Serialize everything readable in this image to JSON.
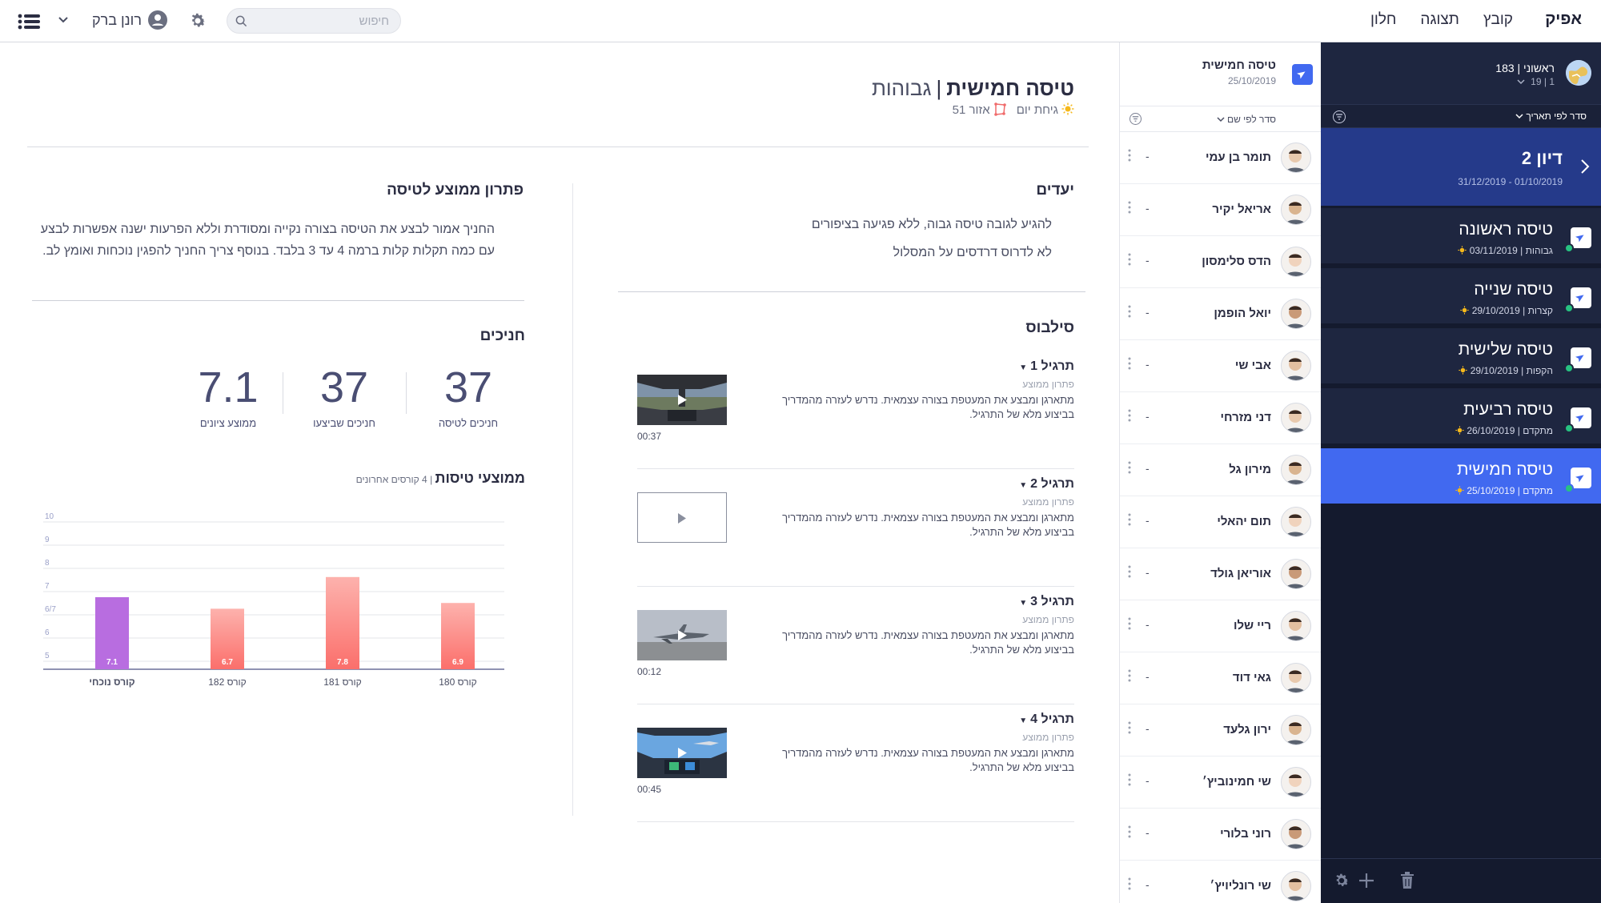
{
  "app": {
    "brand": "אפיק"
  },
  "menu": [
    "קובץ",
    "תצוגה",
    "חלון"
  ],
  "topbar": {
    "search_placeholder": "חיפוש",
    "user_name": "רונן ברק"
  },
  "course": {
    "title": "ראשוני | 183",
    "sub": "1 | 19"
  },
  "dark_sort_label": "סדר לפי תאריך",
  "discussion": {
    "title": "דיון 2",
    "dates": "01/10/2019 - 31/12/2019"
  },
  "flights": [
    {
      "name": "טיסה ראשונה",
      "date": "03/11/2019",
      "topic": "גבוהות",
      "active": false
    },
    {
      "name": "טיסה שנייה",
      "date": "29/10/2019",
      "topic": "קצרות",
      "active": false
    },
    {
      "name": "טיסה שלישית",
      "date": "29/10/2019",
      "topic": "הקפות",
      "active": false
    },
    {
      "name": "טיסה רביעית",
      "date": "26/10/2019",
      "topic": "מתקדם",
      "active": false
    },
    {
      "name": "טיסה חמישית",
      "date": "25/10/2019",
      "topic": "מתקדם",
      "active": true
    }
  ],
  "students_panel": {
    "title": "טיסה חמישית",
    "date": "25/10/2019",
    "sort_label": "סדר לפי שם",
    "dash": "-"
  },
  "students": [
    "תומר בן עמי",
    "אריאל יקיר",
    "הדס סלימסון",
    "יואל הופמן",
    "אבי שי",
    "דני מזרחי",
    "מירון גל",
    "תום יהאלי",
    "אוריאן גולד",
    "ריי שלו",
    "גאי דוד",
    "ירון גלעד",
    "שי חמינוביץ׳",
    "רוני בלורי",
    "שי רונליויץ׳"
  ],
  "main": {
    "title": "טיסה חמישית",
    "subtitle": "גבוהות",
    "time": "גיחת יום",
    "area": "אזור 51"
  },
  "goals": {
    "heading": "יעדים",
    "items": [
      "להגיע לגובה טיסה גבוה, ללא פגיעה בציפורים",
      "לא לדרוס דרדסים על המסלול"
    ]
  },
  "solution": {
    "heading": "פתרון ממוצע לטיסה",
    "text": "החניך אמור לבצע את הטיסה בצורה נקייה ומסודרת וללא הפרעות ישנה אפשרות לבצע עם כמה תקלות קלות ברמה 4 עד 3 בלבד. בנוסף צריך החניך להפגין נוכחות ואומץ לב."
  },
  "syllabus": {
    "heading": "סילבוס",
    "exercises": [
      {
        "title": "תרגיל 1",
        "sub": "פתרון ממוצע",
        "desc": "מתארגן ומבצע את המעטפת בצורה עצמאית. נדרש לעזרה מהמדריך בביצוע מלא של התרגיל.",
        "duration": "00:37",
        "thumb": "cockpit"
      },
      {
        "title": "תרגיל 2",
        "sub": "פתרון ממוצע",
        "desc": "מתארגן ומבצע את המעטפת בצורה עצמאית. נדרש לעזרה מהמדריך בביצוע מלא של התרגיל.",
        "duration": "",
        "thumb": "empty"
      },
      {
        "title": "תרגיל 3",
        "sub": "פתרון ממוצע",
        "desc": "מתארגן ומבצע את המעטפת בצורה עצמאית. נדרש לעזרה מהמדריך בביצוע מלא של התרגיל.",
        "duration": "00:12",
        "thumb": "runway"
      },
      {
        "title": "תרגיל 4",
        "sub": "פתרון ממוצע",
        "desc": "מתארגן ומבצע את המעטפת בצורה עצמאית. נדרש לעזרה מהמדריך בביצוע מלא של התרגיל.",
        "duration": "00:45",
        "thumb": "sky"
      }
    ]
  },
  "trainees": {
    "heading": "חניכים",
    "stats": [
      {
        "value": "37",
        "label": "חניכים לטיסה"
      },
      {
        "value": "37",
        "label": "חניכים שביצעו"
      },
      {
        "value": "7.1",
        "label": "ממוצע ציונים"
      }
    ]
  },
  "chart_title": {
    "main": "ממוצעי טיסות",
    "sub": "4 קורסים אחרונים"
  },
  "chart_data": {
    "type": "bar",
    "categories": [
      "קורס נוכחי",
      "קורס 182",
      "קורס 181",
      "קורס 180"
    ],
    "values": [
      7.1,
      6.7,
      7.8,
      6.9
    ],
    "value_labels": [
      "7.1",
      "6.7",
      "7.8",
      "6.9"
    ],
    "colors": [
      "#b86de0",
      "#fb7e7a",
      "#fb7e7a",
      "#fb7e7a"
    ],
    "ylim": [
      4.6,
      10
    ],
    "yticks": [
      "5",
      "6",
      "6/7",
      "7",
      "8",
      "9",
      "10"
    ],
    "ytick_values": [
      5,
      5.6,
      6.2,
      6.8,
      7.4,
      8.0,
      8.6
    ],
    "grid": true
  }
}
